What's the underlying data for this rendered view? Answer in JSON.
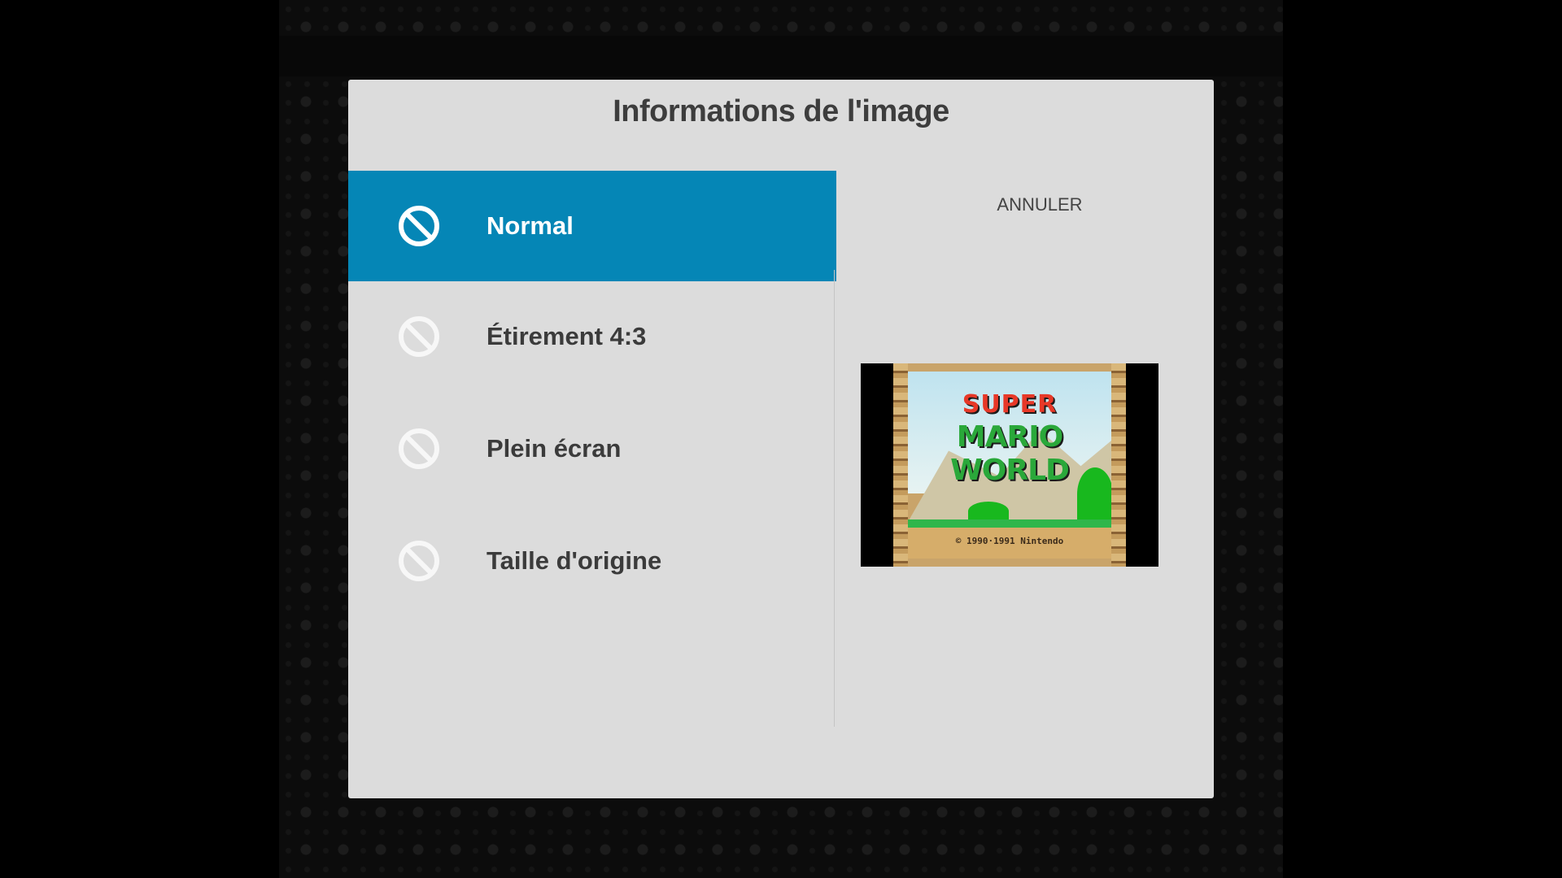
{
  "dialog": {
    "title": "Informations de l'image",
    "cancel_label": "ANNULER"
  },
  "options": [
    {
      "label": "Normal",
      "selected": true,
      "icon": "block-icon"
    },
    {
      "label": "Étirement 4:3",
      "selected": false,
      "icon": "block-icon"
    },
    {
      "label": "Plein écran",
      "selected": false,
      "icon": "block-icon"
    },
    {
      "label": "Taille d'origine",
      "selected": false,
      "icon": "block-icon"
    }
  ],
  "preview": {
    "logo_line1": "SUPER",
    "logo_line2": "MARIO WORLD",
    "copyright": "© 1990·1991 Nintendo"
  },
  "colors": {
    "accent": "#0586b6",
    "dialog_bg": "#dcdcdc"
  }
}
